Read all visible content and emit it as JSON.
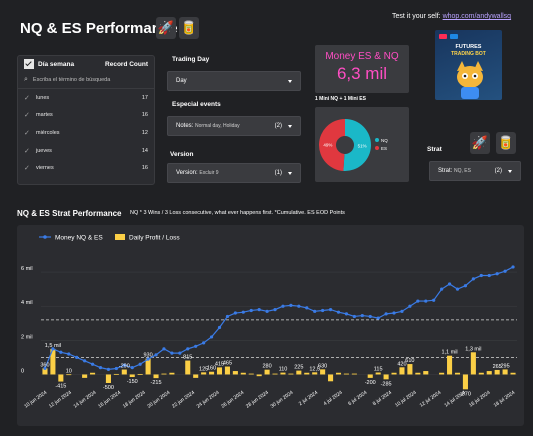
{
  "header": {
    "title": "NQ & ES Performance",
    "icons": [
      "rocket-icon",
      "soda-can-icon"
    ],
    "test_prefix": "Test it your self: ",
    "test_link": "whop.com/andywallsq"
  },
  "filter_list": {
    "col1": "Día semana",
    "col2": "Record Count",
    "search_placeholder": "Escriba el término de búsqueda",
    "items": [
      {
        "name": "lunes",
        "count": "17"
      },
      {
        "name": "martes",
        "count": "16"
      },
      {
        "name": "miércoles",
        "count": "12"
      },
      {
        "name": "jueves",
        "count": "14"
      },
      {
        "name": "viernes",
        "count": "16"
      }
    ]
  },
  "controls": {
    "trading_day_label": "Trading Day",
    "trading_day_value": "Day",
    "events_label": "Especial events",
    "events_prefix": "Notes:",
    "events_value": "Normal day, Holiday",
    "events_count": "(2)",
    "version_label": "Version",
    "version_prefix": "Version:",
    "version_value": "Excluir 9",
    "version_count": "(1)",
    "strat_label": "Strat",
    "strat_prefix": "Strat:",
    "strat_value": "NQ, ES",
    "strat_count": "(2)"
  },
  "kpi": {
    "label": "Money ES & NQ",
    "value": "6,3 mil",
    "caption": "1 Mini NQ + 1 Mini ES"
  },
  "pie": {
    "slices": [
      {
        "name": "NQ",
        "percent": 51,
        "pct_label": "51%",
        "color": "#1ab8c8"
      },
      {
        "name": "ES",
        "percent": 49,
        "pct_label": "49%",
        "color": "#e0383f"
      }
    ]
  },
  "promo": {
    "line1": "FUTURES",
    "line2": "TRADING BOT"
  },
  "chart": {
    "title": "NQ & ES Strat Performance",
    "subtitle": "NQ * 3 Wins / 3 Loss consecutive, what ever happens first.  *Cumulative.  ES EOD Points"
  },
  "chart_data": {
    "type": "line",
    "series": [
      {
        "name": "Money NQ & ES",
        "kind": "line",
        "color": "#3a7be6",
        "values": [
          0.36,
          1.5,
          1.3,
          1.2,
          1.0,
          0.8,
          0.6,
          0.4,
          0.3,
          0.35,
          0.55,
          0.4,
          0.6,
          0.9,
          1.15,
          1.5,
          1.25,
          1.25,
          1.5,
          1.65,
          1.85,
          2.2,
          2.75,
          3.4,
          3.6,
          3.65,
          3.75,
          3.8,
          3.7,
          3.8,
          4.0,
          4.05,
          4.0,
          3.9,
          3.7,
          3.75,
          3.8,
          3.65,
          3.55,
          3.4,
          3.45,
          3.4,
          3.3,
          3.55,
          3.6,
          3.7,
          4.0,
          4.3,
          4.3,
          4.35,
          5.0,
          5.3,
          5.0,
          5.2,
          5.6,
          5.8,
          5.8,
          5.9,
          6.05,
          6.3
        ]
      },
      {
        "name": "Daily Profit / Loss",
        "kind": "bar",
        "color": "#fbcf46",
        "values": [
          0.36,
          1.5,
          -0.415,
          0.01,
          0,
          -0.2,
          0.1,
          0,
          -0.5,
          0.03,
          0.29,
          -0.15,
          0.02,
          0.93,
          -0.215,
          0.05,
          0.1,
          0,
          0.815,
          -0.2,
          0.125,
          0.16,
          0.415,
          0.465,
          0.2,
          0.1,
          0.05,
          -0.1,
          0.28,
          0.05,
          0.11,
          0.05,
          0.225,
          0.1,
          0.126,
          0.3,
          -0.4,
          0.1,
          0.05,
          0.05,
          0,
          -0.2,
          0.115,
          -0.285,
          0.1,
          0.42,
          0.61,
          0.1,
          0.2,
          0,
          0.1,
          1.1,
          0.1,
          -0.87,
          1.3,
          0.1,
          0.2,
          0.265,
          0.295,
          0.1
        ]
      }
    ],
    "data_labels": [
      "360",
      "1,5 mil",
      "-415",
      "10",
      "-500",
      "-290",
      "-150",
      "930",
      "-215",
      "815",
      "125",
      "160",
      "415",
      "465",
      "280",
      "110",
      "225",
      "12,5",
      "630",
      "-200",
      "115",
      "-285",
      "420",
      "610",
      "1,1 mil",
      "-870",
      "1,3 mil",
      "265",
      "295"
    ],
    "categories": [
      "10 jun 2024",
      "12 jun 2024",
      "14 jun 2024",
      "16 jun 2024",
      "18 jun 2024",
      "20 jun 2024",
      "22 jun 2024",
      "24 jun 2024",
      "26 jun 2024",
      "28 jun 2024",
      "30 jun 2024",
      "2 jul 2024",
      "4 jul 2024",
      "6 jul 2024",
      "8 jul 2024",
      "10 jul 2024",
      "12 jul 2024",
      "14 jul 2024",
      "16 jul 2024",
      "18 jul 2024"
    ],
    "y_ticks": [
      "0",
      "2 mil",
      "4 mil",
      "6 mil"
    ],
    "ylim": [
      -0.5,
      7
    ],
    "legend_position": "top-left",
    "reference_lines": [
      {
        "style": "dashed",
        "level": 3.2
      },
      {
        "style": "dashed",
        "level": 1.0
      }
    ]
  }
}
